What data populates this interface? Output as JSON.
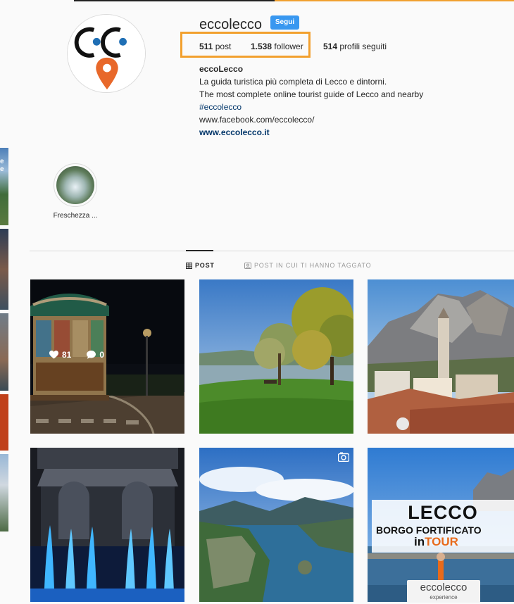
{
  "profile": {
    "username": "eccolecco",
    "follow_label": "Segui",
    "stats": {
      "posts_count": "511",
      "posts_label": "post",
      "followers_count": "1.538",
      "followers_label": "follower",
      "following_count": "514",
      "following_label": "profili seguiti"
    },
    "bio": {
      "name": "eccoLecco",
      "line1": "La guida turistica più completa di Lecco e dintorni.",
      "line2": "The most complete online tourist guide of Lecco and nearby",
      "hashtag": "#eccolecco",
      "facebook": "www.facebook.com/eccolecco/",
      "website": "www.eccolecco.it"
    }
  },
  "left_edge": {
    "fragment": "e e"
  },
  "highlights": [
    {
      "label": "Freschezza ..."
    }
  ],
  "tabs": [
    {
      "label": "POST",
      "icon": "grid-icon",
      "active": true
    },
    {
      "label": "POST IN CUI TI HANNO TAGGATO",
      "icon": "tagged-icon",
      "active": false
    }
  ],
  "posts": [
    {
      "subject": "carousel at night",
      "likes": "81",
      "comments": "0"
    },
    {
      "subject": "lakeside park"
    },
    {
      "subject": "mountain over town rooftops"
    },
    {
      "subject": "illuminated fountains"
    },
    {
      "subject": "lake view from above",
      "type": "video"
    },
    {
      "subject": "promo banner",
      "banner": {
        "line1": "LECCO",
        "line2": "BORGO FORTIFICATO",
        "line3_prefix": "in",
        "line3_highlight": "TOUR",
        "brand": "eccolecco",
        "brand_sub": "experience"
      }
    }
  ],
  "colors": {
    "accent_blue": "#3897f0",
    "highlight_box": "#f2a02e",
    "logo_orange": "#e8682a",
    "logo_blue": "#1f6fb5"
  }
}
